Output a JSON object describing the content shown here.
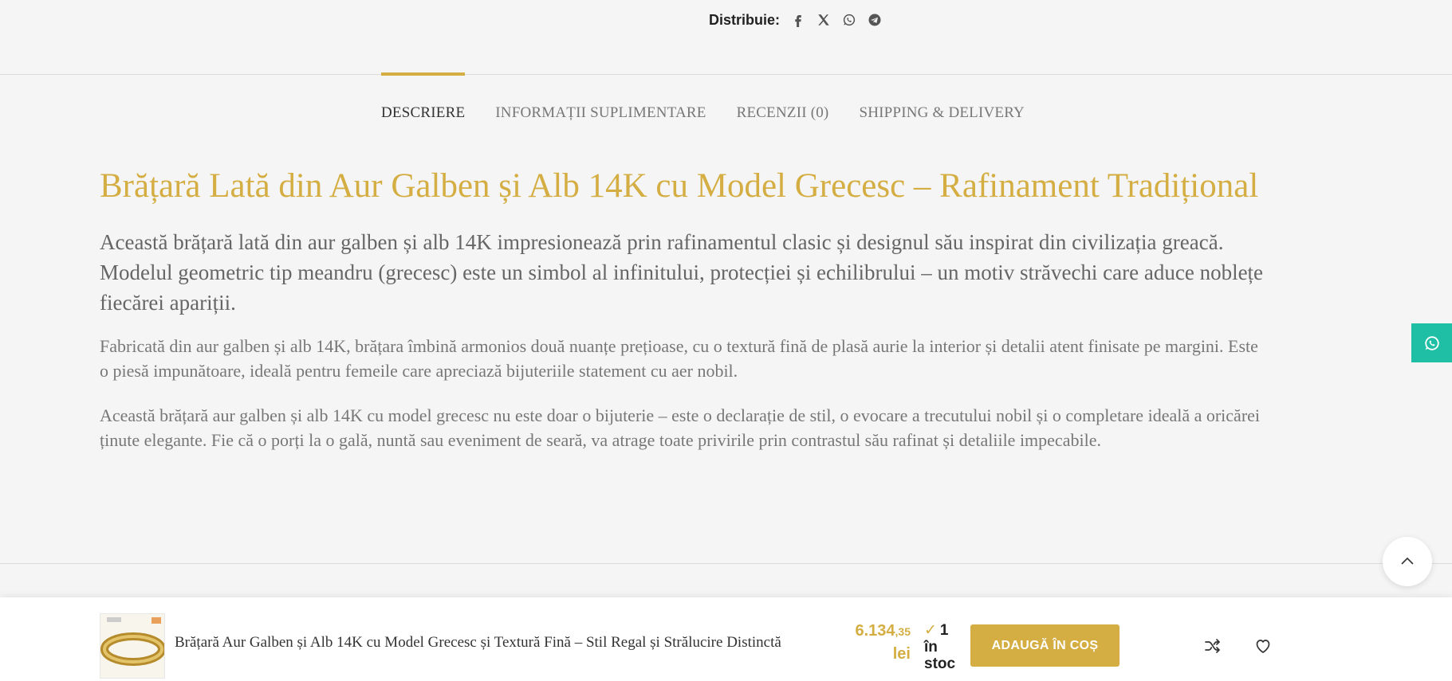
{
  "share": {
    "label": "Distribuie:",
    "icons": [
      "facebook-icon",
      "x-icon",
      "whatsapp-icon",
      "telegram-icon"
    ]
  },
  "tabs": [
    {
      "label": "DESCRIERE",
      "active": true
    },
    {
      "label": "INFORMAȚII SUPLIMENTARE",
      "active": false
    },
    {
      "label": "RECENZII (0)",
      "active": false
    },
    {
      "label": "SHIPPING & DELIVERY",
      "active": false
    }
  ],
  "description": {
    "title": "Brățară Lată din Aur Galben și Alb 14K cu Model Grecesc – Rafinament Tradițional",
    "lead": "Această brățară lată din aur galben și alb 14K impresionează prin rafinamentul clasic și designul său inspirat din civilizația greacă. Modelul geometric tip meandru (grecesc) este un simbol al infinitului, protecției și echilibrului – un motiv străvechi care aduce noblețe fiecărei apariții.",
    "paragraph_1": "Fabricată din aur galben și alb 14K, brățara îmbină armonios două nuanțe prețioase, cu o textură fină de plasă aurie la interior și detalii atent finisate pe margini. Este o piesă impunătoare, ideală pentru femeile care apreciază bijuteriile statement cu aer nobil.",
    "paragraph_2": "Această brățară aur galben și alb 14K cu model grecesc nu este doar o bijuterie – este o declarație de stil, o evocare a trecutului nobil și o completare ideală a oricărei ținute elegante. Fie că o porți la o gală, nuntă sau eveniment de seară, va atrage toate privirile prin contrastul său rafinat și detaliile impecabile."
  },
  "sticky_bar": {
    "product_name": "Brățară Aur Galben și Alb 14K cu Model Grecesc și Textură Fină – Stil Regal și Strălucire Distinctă",
    "price_main": "6.134",
    "price_decimals": ",35",
    "currency": "lei",
    "stock_check": "✓",
    "stock_text": "1 în stoc",
    "add_to_cart": "ADAUGĂ ÎN COȘ"
  },
  "colors": {
    "accent_gold": "#d4ae43",
    "whatsapp_green": "#1fbfa6",
    "background": "#f5f5f5"
  }
}
